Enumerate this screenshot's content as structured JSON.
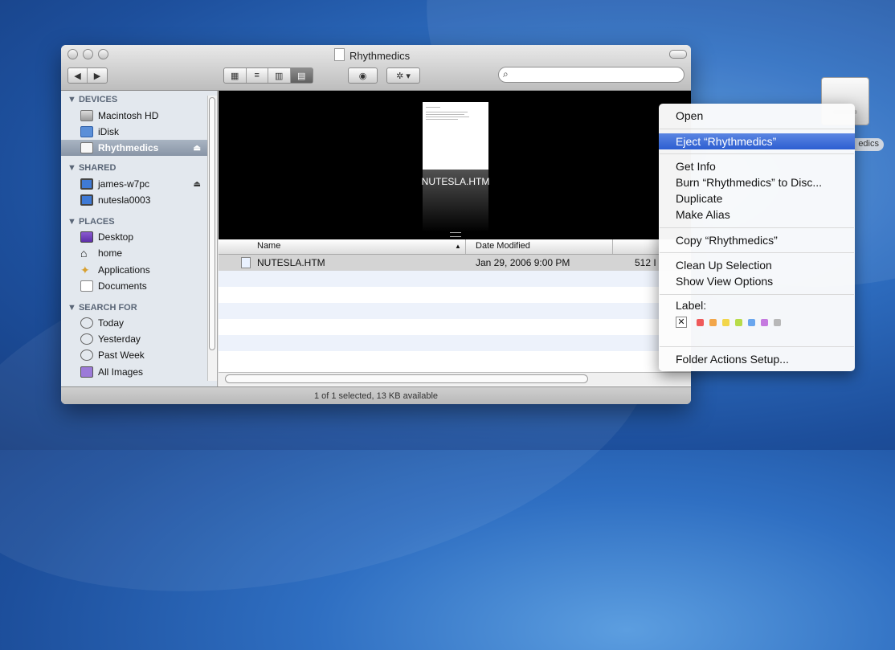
{
  "window": {
    "title": "Rhythmedics",
    "view_buttons": [
      "icon-view",
      "list-view",
      "column-view",
      "coverflow-view"
    ],
    "search_placeholder": ""
  },
  "sidebar": {
    "sections": [
      {
        "label": "▼ DEVICES",
        "items": [
          {
            "label": "Macintosh HD",
            "icon": "hard-drive-icon"
          },
          {
            "label": "iDisk",
            "icon": "idisk-icon"
          },
          {
            "label": "Rhythmedics",
            "icon": "disk-icon",
            "selected": true,
            "eject": "⏏"
          }
        ]
      },
      {
        "label": "▼ SHARED",
        "items": [
          {
            "label": "james-w7pc",
            "icon": "network-computer-icon",
            "eject": "⏏"
          },
          {
            "label": "nutesla0003",
            "icon": "network-computer-icon"
          }
        ]
      },
      {
        "label": "▼ PLACES",
        "items": [
          {
            "label": "Desktop",
            "icon": "desktop-icon"
          },
          {
            "label": "home",
            "icon": "home-icon"
          },
          {
            "label": "Applications",
            "icon": "applications-icon"
          },
          {
            "label": "Documents",
            "icon": "documents-icon"
          }
        ]
      },
      {
        "label": "▼ SEARCH FOR",
        "items": [
          {
            "label": "Today",
            "icon": "clock-icon"
          },
          {
            "label": "Yesterday",
            "icon": "clock-icon"
          },
          {
            "label": "Past Week",
            "icon": "clock-icon"
          },
          {
            "label": "All Images",
            "icon": "images-icon"
          }
        ]
      }
    ]
  },
  "preview": {
    "filename": "NUTESLA.HTM"
  },
  "list": {
    "columns": [
      "Name",
      "Date Modified"
    ],
    "rows": [
      {
        "name": "NUTESLA.HTM",
        "date": "Jan 29, 2006 9:00 PM",
        "size": "512 I"
      }
    ]
  },
  "status": "1 of 1 selected, 13 KB available",
  "desktop_disk": {
    "label": "edics"
  },
  "context_menu": {
    "open": "Open",
    "eject": "Eject “Rhythmedics”",
    "get_info": "Get Info",
    "burn": "Burn “Rhythmedics” to Disc...",
    "duplicate": "Duplicate",
    "make_alias": "Make Alias",
    "copy": "Copy “Rhythmedics”",
    "clean_up": "Clean Up Selection",
    "show_view_options": "Show View Options",
    "label": "Label:",
    "label_none": "✕",
    "label_colors": [
      "#ef5a5a",
      "#f2a64a",
      "#f2d64a",
      "#b8dc4a",
      "#6aa6ee",
      "#c57adf",
      "#b8b8b8"
    ],
    "folder_actions": "Folder Actions Setup..."
  }
}
